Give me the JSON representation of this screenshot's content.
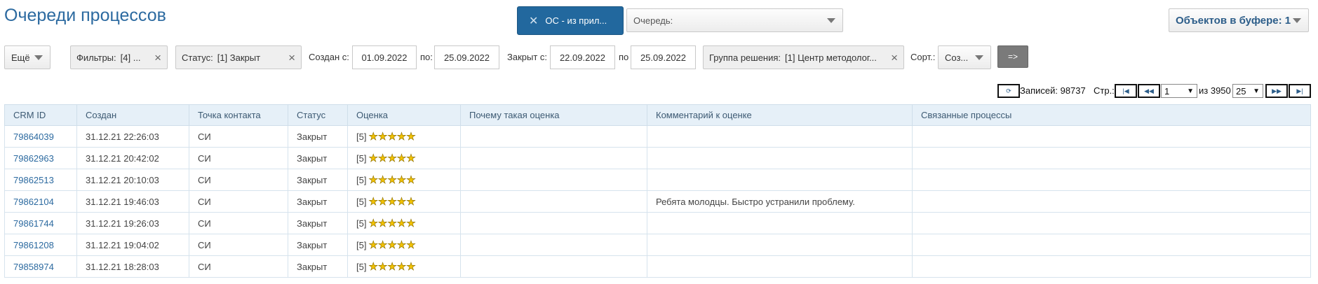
{
  "page_title": "Очереди процессов",
  "queue_tab": {
    "label": "ОС - из прил..."
  },
  "queue_select": {
    "value": "Очередь:"
  },
  "buffer": {
    "label": "Объектов в буфере: 1"
  },
  "filters": {
    "more_label": "Ещё",
    "filters_label": "Фильтры:",
    "filters_value": "[4] ...",
    "status_label": "Статус:",
    "status_value": "[1] Закрыт",
    "created_from_label": "Создан с:",
    "created_from": "01.09.2022",
    "created_to_label": "по:",
    "created_to": "25.09.2022",
    "closed_from_label": "Закрыт с:",
    "closed_from": "22.09.2022",
    "closed_to_label": "по",
    "closed_to": "25.09.2022",
    "group_label": "Группа решения:",
    "group_value": "[1] Центр методолог...",
    "sort_label": "Сорт.:",
    "sort_value": "Соз...",
    "apply_label": "=>"
  },
  "pager": {
    "records_label": "Записей: 98737",
    "page_label": "Стр.:",
    "page_value": "1",
    "of_label": "из 3950",
    "page_size": "25"
  },
  "table": {
    "columns": [
      "CRM ID",
      "Создан",
      "Точка контакта",
      "Статус",
      "Оценка",
      "Почему такая оценка",
      "Комментарий к оценке",
      "Связанные процессы"
    ],
    "rows": [
      {
        "id": "79864039",
        "created": "31.12.21 22:26:03",
        "contact": "СИ",
        "status": "Закрыт",
        "rating": "[5]",
        "stars": 5,
        "why": "",
        "comment": "",
        "related": ""
      },
      {
        "id": "79862963",
        "created": "31.12.21 20:42:02",
        "contact": "СИ",
        "status": "Закрыт",
        "rating": "[5]",
        "stars": 5,
        "why": "",
        "comment": "",
        "related": ""
      },
      {
        "id": "79862513",
        "created": "31.12.21 20:10:03",
        "contact": "СИ",
        "status": "Закрыт",
        "rating": "[5]",
        "stars": 5,
        "why": "",
        "comment": "",
        "related": ""
      },
      {
        "id": "79862104",
        "created": "31.12.21 19:46:03",
        "contact": "СИ",
        "status": "Закрыт",
        "rating": "[5]",
        "stars": 5,
        "why": "",
        "comment": "Ребята молодцы. Быстро устранили проблему.",
        "related": ""
      },
      {
        "id": "79861744",
        "created": "31.12.21 19:26:03",
        "contact": "СИ",
        "status": "Закрыт",
        "rating": "[5]",
        "stars": 5,
        "why": "",
        "comment": "",
        "related": ""
      },
      {
        "id": "79861208",
        "created": "31.12.21 19:04:02",
        "contact": "СИ",
        "status": "Закрыт",
        "rating": "[5]",
        "stars": 5,
        "why": "",
        "comment": "",
        "related": ""
      },
      {
        "id": "79858974",
        "created": "31.12.21 18:28:03",
        "contact": "СИ",
        "status": "Закрыт",
        "rating": "[5]",
        "stars": 5,
        "why": "",
        "comment": "",
        "related": ""
      }
    ]
  },
  "colors": {
    "accent": "#22689e",
    "link": "#2c6aa0",
    "header_bg": "#e6f0f8",
    "star": "#f2c200"
  }
}
